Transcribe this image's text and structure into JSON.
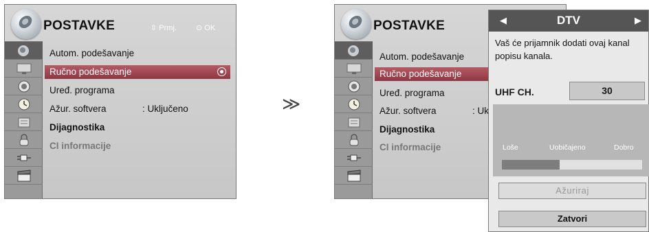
{
  "menu": {
    "title": "POSTAVKE",
    "hint_move": "Prmj.",
    "hint_ok": "OK",
    "items": [
      {
        "label": "Autom. podešavanje"
      },
      {
        "label": "Ručno podešavanje"
      },
      {
        "label": "Uređ. programa"
      },
      {
        "label": "Ažur. softvera",
        "value": ": Uključeno",
        "value_partial": ": Ukl"
      },
      {
        "label": "Dijagnostika"
      },
      {
        "label": "CI informacije"
      }
    ],
    "sidebar_icons": [
      "satellite-dish-icon",
      "tv-screen-icon",
      "speaker-icon",
      "clock-icon",
      "lock-icon",
      "padlock-icon",
      "plug-icon",
      "clapperboard-icon"
    ]
  },
  "transition_arrow": "≫",
  "dialog": {
    "title": "DTV",
    "left_arrow": "◀",
    "right_arrow": "▶",
    "message": "Vaš će prijamnik dodati ovaj kanal popisu kanala.",
    "channel_label": "UHF CH.",
    "channel_value": "30",
    "signal": {
      "low_label": "Loše",
      "mid_label": "Uobičajeno",
      "high_label": "Dobro",
      "level_fraction": 0.41
    },
    "update_button": "Ažuriraj",
    "close_button": "Zatvori"
  }
}
